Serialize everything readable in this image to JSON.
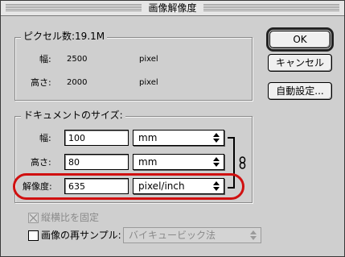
{
  "window": {
    "title": "画像解像度"
  },
  "pixel_dimensions": {
    "legend": "ピクセル数:19.1M",
    "width_label": "幅:",
    "width_value": "2500",
    "width_unit": "pixel",
    "height_label": "高さ:",
    "height_value": "2000",
    "height_unit": "pixel"
  },
  "document_size": {
    "legend": "ドキュメントのサイズ:",
    "width_label": "幅:",
    "width_value": "100",
    "width_unit": "mm",
    "height_label": "高さ:",
    "height_value": "80",
    "height_unit": "mm",
    "resolution_label": "解像度:",
    "resolution_value": "635",
    "resolution_unit": "pixel/inch"
  },
  "options": {
    "constrain_label": "縦横比を固定",
    "constrain_checked": true,
    "resample_label": "画像の再サンプル:",
    "resample_checked": false,
    "resample_method": "バイキュービック法"
  },
  "buttons": {
    "ok": "OK",
    "cancel": "キャンセル",
    "auto": "自動設定..."
  },
  "highlight_color": "#d01010"
}
